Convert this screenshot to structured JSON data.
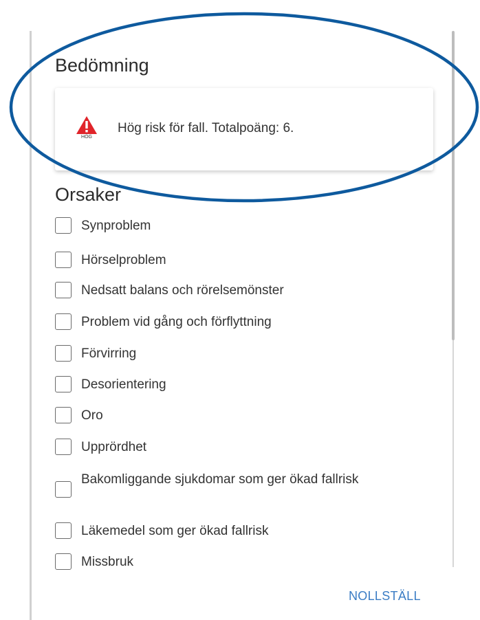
{
  "assessment": {
    "heading": "Bedömning",
    "risk_level_label": "HÖG",
    "risk_message": "Hög risk för fall. Totalpoäng: 6.",
    "risk_color": "#e0242a",
    "risk_icon": "warning-triangle-icon"
  },
  "causes": {
    "heading": "Orsaker",
    "items": [
      {
        "label": "Synproblem",
        "checked": false
      },
      {
        "label": "Hörselproblem",
        "checked": false
      },
      {
        "label": "Nedsatt balans och rörelsemönster",
        "checked": false
      },
      {
        "label": "Problem vid gång och förflyttning",
        "checked": false
      },
      {
        "label": "Förvirring",
        "checked": false
      },
      {
        "label": "Desorientering",
        "checked": false
      },
      {
        "label": "Oro",
        "checked": false
      },
      {
        "label": "Upprördhet",
        "checked": false
      },
      {
        "label": "Bakomliggande sjukdomar som ger ökad fallrisk",
        "checked": false
      },
      {
        "label": "Läkemedel som ger ökad fallrisk",
        "checked": false
      },
      {
        "label": "Missbruk",
        "checked": false
      }
    ]
  },
  "actions": {
    "reset_label": "NOLLSTÄLL"
  },
  "colors": {
    "accent": "#3a7cc4",
    "annotation_ellipse": "#0e5a9e"
  }
}
